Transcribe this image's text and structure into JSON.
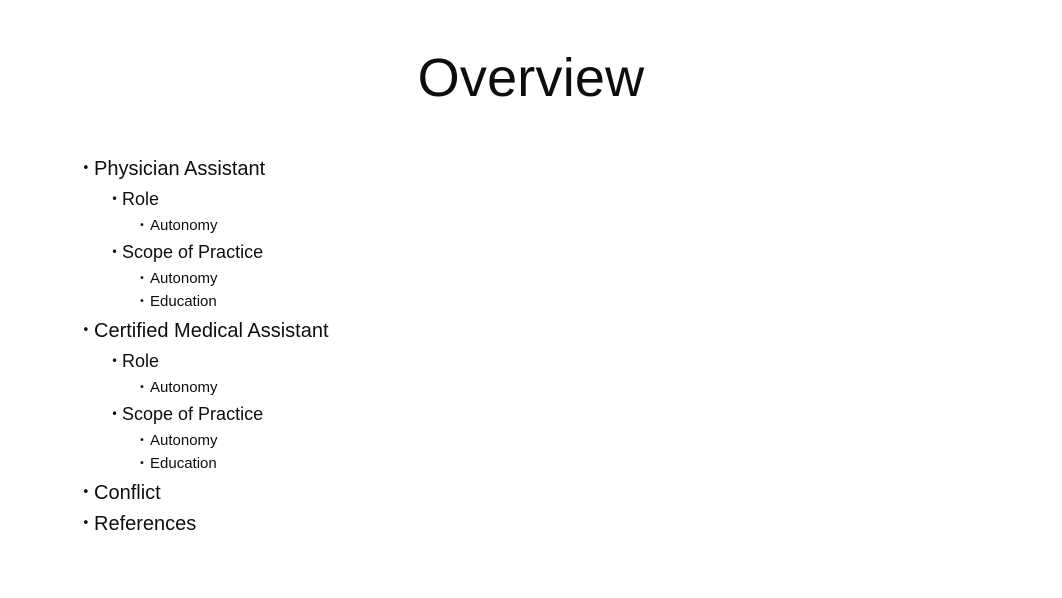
{
  "slide": {
    "title": "Overview",
    "background_color": "#ffffff",
    "text_color": "#0d0d0d",
    "bullet_glyph": "•",
    "outline": [
      {
        "level": 1,
        "text": "Physician Assistant"
      },
      {
        "level": 2,
        "text": "Role"
      },
      {
        "level": 3,
        "text": "Autonomy"
      },
      {
        "level": 2,
        "text": "Scope of Practice"
      },
      {
        "level": 3,
        "text": "Autonomy"
      },
      {
        "level": 3,
        "text": "Education"
      },
      {
        "level": 1,
        "text": "Certified Medical Assistant"
      },
      {
        "level": 2,
        "text": "Role"
      },
      {
        "level": 3,
        "text": "Autonomy"
      },
      {
        "level": 2,
        "text": "Scope of Practice"
      },
      {
        "level": 3,
        "text": "Autonomy"
      },
      {
        "level": 3,
        "text": "Education"
      },
      {
        "level": 1,
        "text": "Conflict"
      },
      {
        "level": 1,
        "text": "References"
      }
    ]
  }
}
